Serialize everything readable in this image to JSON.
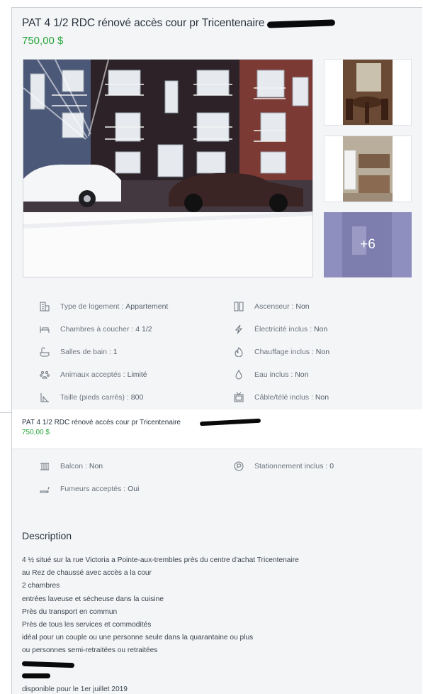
{
  "listing": {
    "title": "PAT 4 1/2 RDC rénové accès cour pr Tricentenaire",
    "price": "750,00 $",
    "more_photos": "+6"
  },
  "features_left": [
    {
      "icon": "building-icon",
      "label": "Type de logement :",
      "value": "Appartement"
    },
    {
      "icon": "bed-icon",
      "label": "Chambres à coucher :",
      "value": "4 1/2"
    },
    {
      "icon": "bathtub-icon",
      "label": "Salles de bain :",
      "value": "1"
    },
    {
      "icon": "paw-icon",
      "label": "Animaux acceptés :",
      "value": "Limité"
    },
    {
      "icon": "ruler-icon",
      "label": "Taille (pieds carrés) :",
      "value": "800"
    }
  ],
  "features_right": [
    {
      "icon": "elevator-icon",
      "label": "Ascenseur :",
      "value": "Non"
    },
    {
      "icon": "lightning-icon",
      "label": "Électricité inclus :",
      "value": "Non"
    },
    {
      "icon": "flame-icon",
      "label": "Chauffage inclus :",
      "value": "Non"
    },
    {
      "icon": "drop-icon",
      "label": "Eau inclus :",
      "value": "Non"
    },
    {
      "icon": "tv-icon",
      "label": "Câble/télé inclus :",
      "value": "Non"
    }
  ],
  "features_extra": [
    {
      "icon": "balcony-icon",
      "label": "Balcon :",
      "value": "Non"
    },
    {
      "icon": "parking-icon",
      "label": "Stationnement inclus :",
      "value": "0"
    },
    {
      "icon": "cigarette-icon",
      "label": "Fumeurs acceptés :",
      "value": "Oui"
    }
  ],
  "description": {
    "heading": "Description",
    "lines": [
      "4 ½ situé sur la rue Victoria a Pointe-aux-trembles près du centre d'achat Tricentenaire",
      "au Rez de chaussé avec accès a la cour",
      "2 chambres",
      "entrées laveuse et sécheuse dans la cuisine",
      "Près du transport en commun",
      "Près de tous les services et commodités",
      "idéal pour un couple ou une personne seule dans la quarantaine ou plus",
      "ou personnes semi-retraitées ou retraitées"
    ],
    "availability": "disponible pour le 1er juillet 2019"
  },
  "colors": {
    "price": "#26a63b",
    "more_overlay": "#8e8fbf"
  }
}
